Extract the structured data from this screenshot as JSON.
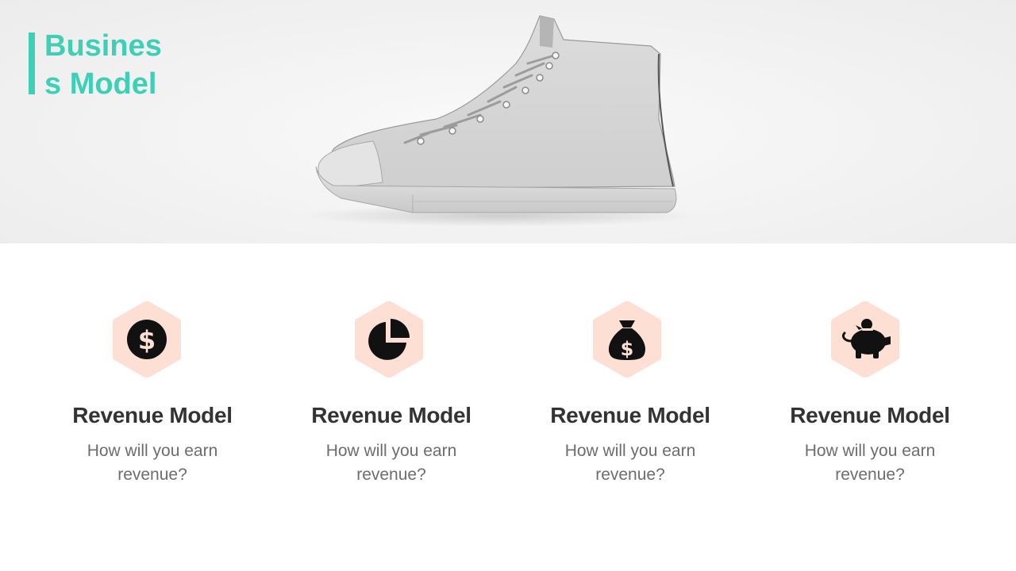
{
  "slide": {
    "title": "Business Model",
    "accent_color": "#3ecfb6",
    "hero_image": "white-high-top-sneaker",
    "icon_bg_color": "#fde0d3"
  },
  "features": [
    {
      "icon": "dollar-circle-icon",
      "title": "Revenue Model",
      "description": "How will you earn revenue?"
    },
    {
      "icon": "pie-chart-icon",
      "title": "Revenue Model",
      "description": "How will you earn revenue?"
    },
    {
      "icon": "money-bag-icon",
      "title": "Revenue Model",
      "description": "How will you earn revenue?"
    },
    {
      "icon": "piggy-bank-icon",
      "title": "Revenue Model",
      "description": "How will you earn revenue?"
    }
  ]
}
